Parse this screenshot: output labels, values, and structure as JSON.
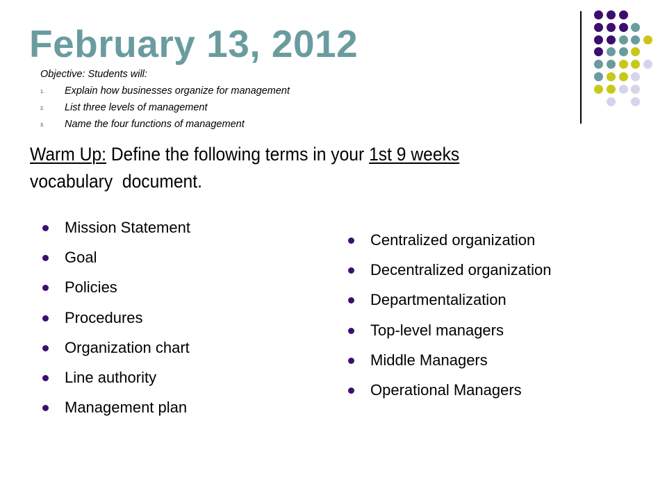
{
  "slide": {
    "title": "February 13, 2012",
    "objective": {
      "heading": "Objective: Students will:",
      "items": [
        {
          "number": "1.",
          "text": "Explain how businesses organize for management"
        },
        {
          "number": "2.",
          "text": "List three levels of management"
        },
        {
          "number": "3.",
          "text": "Name the four functions of management"
        }
      ]
    },
    "warmup": {
      "label": "Warm Up:",
      "text_before_link": " Define the following terms in your ",
      "underlined_phrase": "1st 9 weeks",
      "line2": "vocabulary  document."
    },
    "terms_left": [
      "Mission Statement",
      "Goal",
      "Policies",
      "Procedures",
      "Organization chart",
      "Line authority",
      "Management plan"
    ],
    "terms_right": [
      "Centralized organization",
      "Decentralized organization",
      "Departmentalization",
      "Top-level managers",
      "Middle Managers",
      "Operational Managers"
    ],
    "colors": {
      "title": "#6a9c9f",
      "bullet": "#3b0f6f",
      "dot_purple": "#3b0f6f",
      "dot_teal": "#6a9c9f",
      "dot_yellow": "#c9c818",
      "dot_lavender": "#d4d4ea"
    },
    "decoration": {
      "dot_grid": [
        [
          "P",
          "P",
          "P",
          "",
          ""
        ],
        [
          "P",
          "P",
          "P",
          "T",
          ""
        ],
        [
          "P",
          "P",
          "T",
          "T",
          "Y"
        ],
        [
          "P",
          "T",
          "T",
          "Y",
          ""
        ],
        [
          "T",
          "T",
          "Y",
          "Y",
          "L"
        ],
        [
          "T",
          "Y",
          "Y",
          "L",
          ""
        ],
        [
          "Y",
          "Y",
          "L",
          "L",
          ""
        ],
        [
          "",
          "L",
          "",
          "L",
          ""
        ]
      ]
    }
  }
}
